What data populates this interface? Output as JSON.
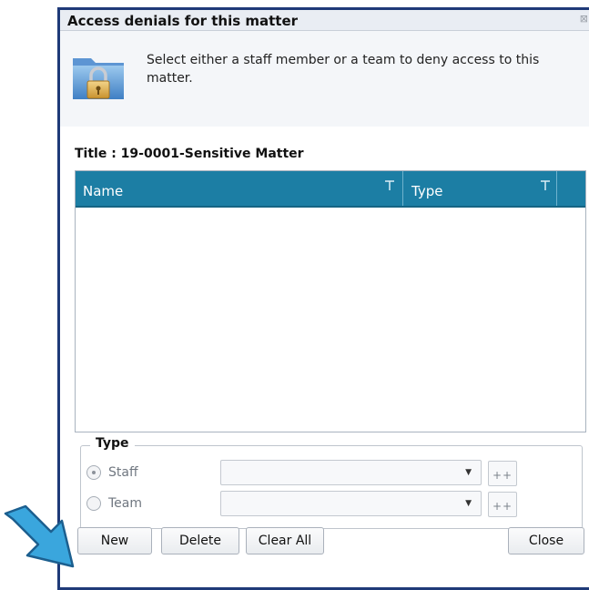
{
  "window": {
    "title": "Access denials for this matter",
    "close_glyph": "⊠",
    "instructions": "Select either a staff member or a team to deny access to this matter.",
    "icon": "locked-folder-icon"
  },
  "matter": {
    "title": "Title : 19-0001-Sensitive Matter"
  },
  "grid": {
    "columns": [
      {
        "label": "Name"
      },
      {
        "label": "Type"
      }
    ],
    "rows": [],
    "header_color": "#1c7ea4"
  },
  "type_group": {
    "legend": "Type",
    "options": [
      {
        "label": "Staff",
        "selected": true,
        "value": "",
        "add_label": "++"
      },
      {
        "label": "Team",
        "selected": false,
        "value": "",
        "add_label": "++"
      }
    ]
  },
  "buttons": {
    "new": "New",
    "delete": "Delete",
    "clear_all": "Clear All",
    "close": "Close"
  },
  "annotation": {
    "arrow_color": "#3aa6dd",
    "icon": "pointer-arrow"
  }
}
